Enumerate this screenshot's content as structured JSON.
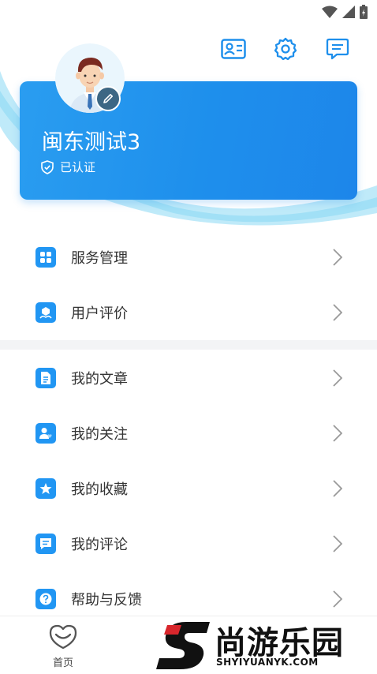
{
  "status_bar": {
    "icons": [
      "wifi-icon",
      "signal-icon",
      "battery-charging-icon"
    ]
  },
  "header": {
    "icons": [
      "id-card-icon",
      "settings-gear-icon",
      "message-icon"
    ]
  },
  "profile": {
    "username": "闽东测试3",
    "verified_label": "已认证"
  },
  "menu_group_1": [
    {
      "label": "服务管理",
      "icon": "grid-icon"
    },
    {
      "label": "用户评价",
      "icon": "review-badge-icon"
    }
  ],
  "menu_group_2": [
    {
      "label": "我的文章",
      "icon": "document-icon"
    },
    {
      "label": "我的关注",
      "icon": "follow-user-icon"
    },
    {
      "label": "我的收藏",
      "icon": "star-icon"
    },
    {
      "label": "我的评论",
      "icon": "comment-icon"
    },
    {
      "label": "帮助与反馈",
      "icon": "help-icon"
    }
  ],
  "tabbar": {
    "home_label": "首页"
  },
  "watermark": {
    "brand": "尚游乐园",
    "url": "SHYIYUANYK.COM"
  },
  "colors": {
    "primary": "#1e8fec",
    "accent_light": "#9fe0f5",
    "icon_blue": "#2196f3"
  }
}
